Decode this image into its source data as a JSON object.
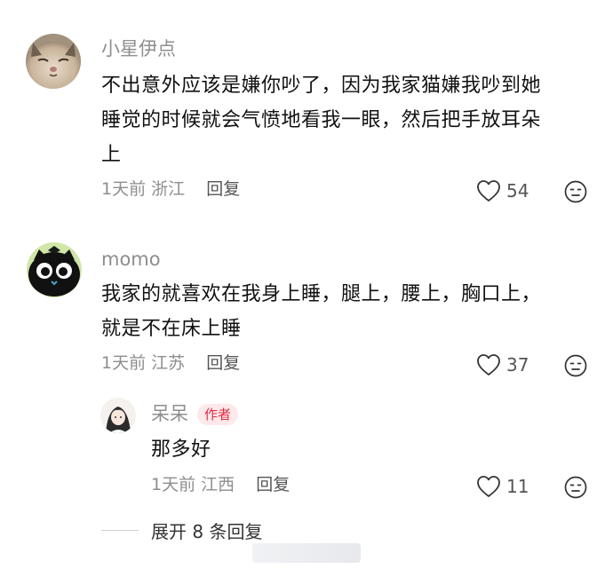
{
  "comments": [
    {
      "username": "小星伊点",
      "lines": [
        "不出意外应该是嫌你吵了，因为我家猫嫌我吵到她",
        "睡觉的时候就会气愤地看我一眼，然后把手放耳朵",
        "上"
      ],
      "time": "1天前",
      "location": "浙江",
      "reply_label": "回复",
      "likes": "54"
    },
    {
      "username": "momo",
      "lines": [
        "我家的就喜欢在我身上睡，腿上，腰上，胸口上，",
        "就是不在床上睡"
      ],
      "time": "1天前",
      "location": "江苏",
      "reply_label": "回复",
      "likes": "37"
    }
  ],
  "reply": {
    "username": "呆呆",
    "badge": "作者",
    "lines": [
      "那多好"
    ],
    "time": "1天前",
    "location": "江西",
    "reply_label": "回复",
    "likes": "11"
  },
  "expand_label": "展开 8 条回复",
  "icons": {
    "like": "heart-outline-icon",
    "dislike": "frown-face-icon"
  },
  "colors": {
    "username": "#8e8e8e",
    "badge_text": "#e02e45",
    "badge_bg": "#fde8ea"
  }
}
